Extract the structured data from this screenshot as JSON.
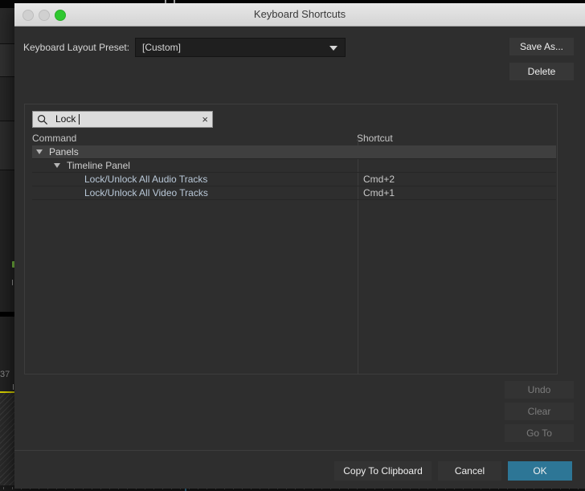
{
  "window": {
    "title": "Keyboard Shortcuts",
    "traffic_lights": {
      "close": "close-button",
      "minimize": "minimize-button",
      "maximize": "maximize-button"
    }
  },
  "preset": {
    "label": "Keyboard Layout Preset:",
    "value": "[Custom]",
    "save_as_label": "Save As...",
    "delete_label": "Delete"
  },
  "search": {
    "value": "Lock",
    "placeholder": "",
    "clear_glyph": "×"
  },
  "columns": {
    "command": "Command",
    "shortcut": "Shortcut"
  },
  "rows": [
    {
      "command": "Panels",
      "shortcut": "",
      "indent": 0,
      "expanded": true,
      "has_twisty": true,
      "selected": true,
      "kind": "group"
    },
    {
      "command": "Timeline Panel",
      "shortcut": "",
      "indent": 1,
      "expanded": true,
      "has_twisty": true,
      "selected": false,
      "kind": "sub"
    },
    {
      "command": "Lock/Unlock All Audio Tracks",
      "shortcut": "Cmd+2",
      "indent": 2,
      "expanded": false,
      "has_twisty": false,
      "selected": false,
      "kind": "leaf"
    },
    {
      "command": "Lock/Unlock All Video Tracks",
      "shortcut": "Cmd+1",
      "indent": 2,
      "expanded": false,
      "has_twisty": false,
      "selected": false,
      "kind": "leaf"
    }
  ],
  "actions": {
    "undo": "Undo",
    "clear": "Clear",
    "go_to": "Go To"
  },
  "footer": {
    "copy_to_clipboard": "Copy To Clipboard",
    "cancel": "Cancel",
    "ok": "OK"
  },
  "background": {
    "timecode_fragment": "37"
  },
  "colors": {
    "accent": "#2d7696",
    "dialog_bg": "#2e2e2e",
    "titlebar": "#e0e0e0",
    "maximize_green": "#2fc830",
    "command_text": "#b9c8d8",
    "playhead": "#3b8fb5",
    "marker_yellow": "#d9d200"
  }
}
